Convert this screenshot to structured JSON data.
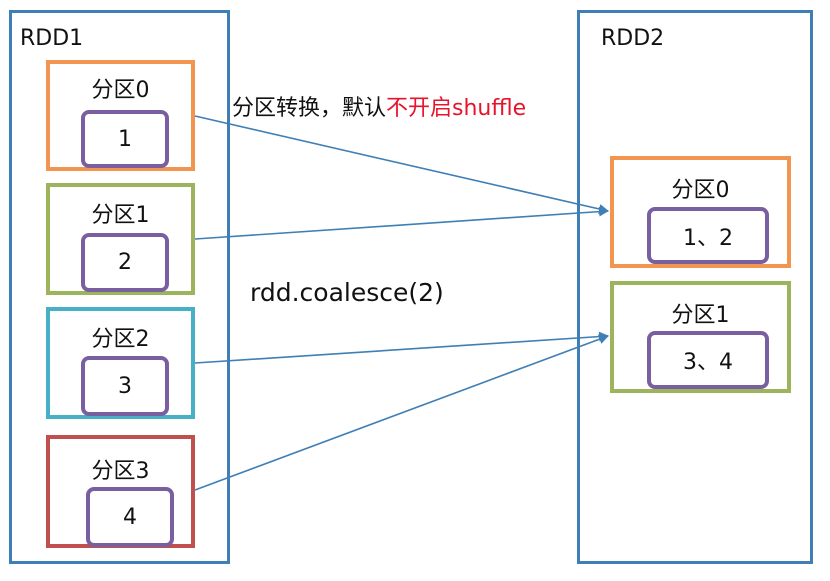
{
  "rdd1": {
    "title": "RDD1",
    "partitions": [
      {
        "label": "分区0",
        "value": "1",
        "color": "#f29550"
      },
      {
        "label": "分区1",
        "value": "2",
        "color": "#9cb55d"
      },
      {
        "label": "分区2",
        "value": "3",
        "color": "#47b0c6"
      },
      {
        "label": "分区3",
        "value": "4",
        "color": "#c0504d"
      }
    ]
  },
  "rdd2": {
    "title": "RDD2",
    "partitions": [
      {
        "label": "分区0",
        "value": "1、2",
        "color": "#f29550"
      },
      {
        "label": "分区1",
        "value": "3、4",
        "color": "#9cb55d"
      }
    ]
  },
  "annotation": {
    "prefix": "分区转换，默认",
    "highlight": "不开启shuffle",
    "highlight_color": "#e8132a"
  },
  "operation": "rdd.coalesce(2)",
  "colors": {
    "rdd_border": "#3f7fb5",
    "value_box": "#7a5fa0",
    "arrow": "#3f7fb5"
  }
}
